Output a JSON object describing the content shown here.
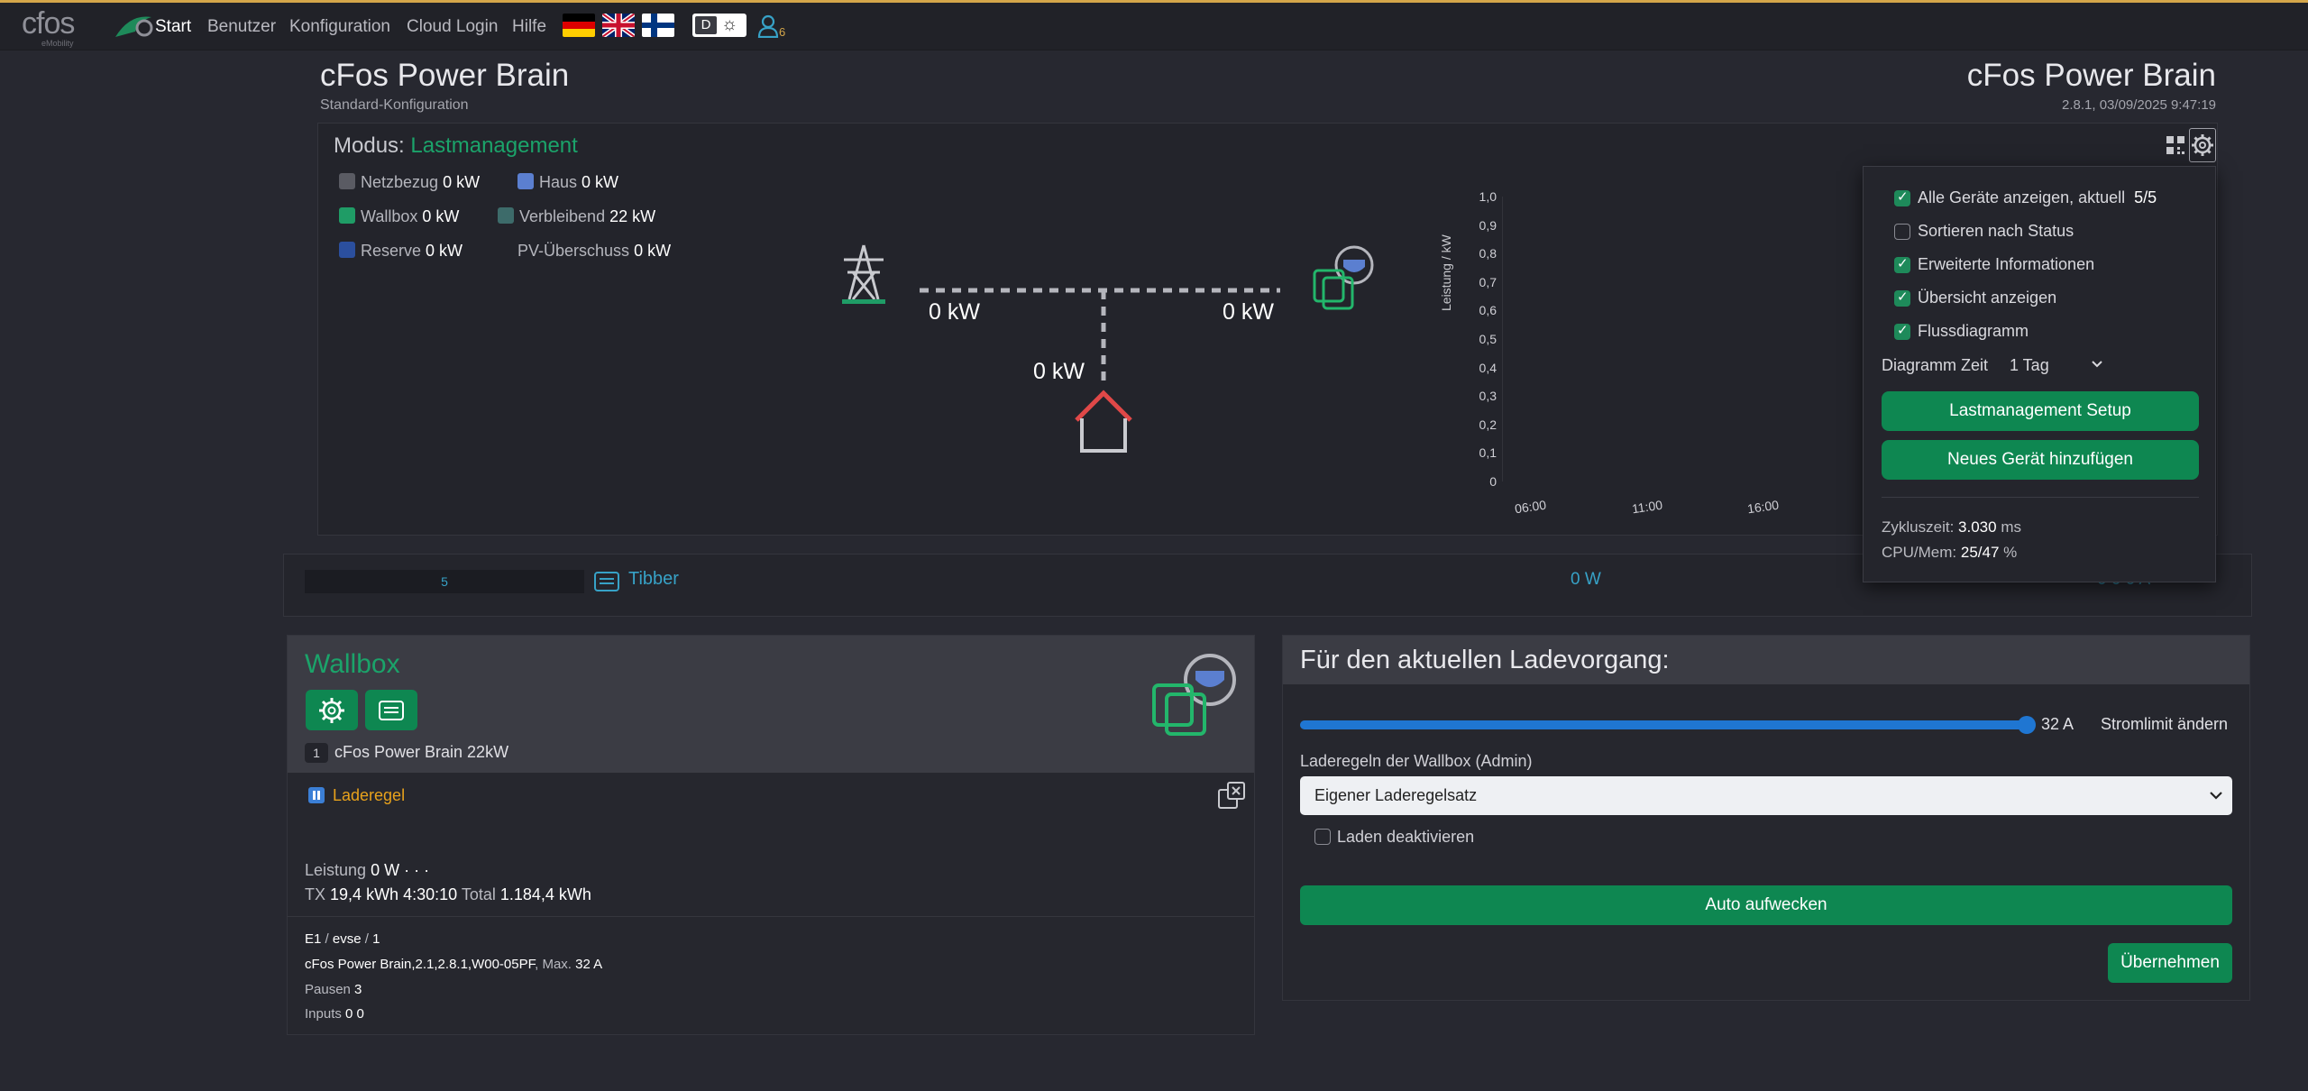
{
  "nav": {
    "logo": "cfos",
    "logo_sub": "eMobility",
    "items": [
      "Start",
      "Benutzer",
      "Konfiguration",
      "Cloud Login",
      "Hilfe"
    ],
    "user_count": "6"
  },
  "header": {
    "title_left": "cFos Power Brain",
    "subtitle_left": "Standard-Konfiguration",
    "title_right": "cFos Power Brain",
    "version_info": "2.8.1, 03/09/2025 9:47:19"
  },
  "mode": {
    "label": "Modus:",
    "value": "Lastmanagement"
  },
  "legend": [
    {
      "name": "Netzbezug",
      "value": "0 kW",
      "color": "#5a5b63"
    },
    {
      "name": "Haus",
      "value": "0 kW",
      "color": "#5b7fd0"
    },
    {
      "name": "Wallbox",
      "value": "0 kW",
      "color": "#1f9c66"
    },
    {
      "name": "Verbleibend",
      "value": "22 kW",
      "color": "#3d6b6a"
    },
    {
      "name": "Reserve",
      "value": "0 kW",
      "color": "#2b4f9e"
    },
    {
      "name": "PV-Überschuss",
      "value": "0 kW",
      "color": ""
    }
  ],
  "flow": {
    "grid": "0 kW",
    "wallbox": "0 kW",
    "house": "0 kW"
  },
  "chart_data": {
    "type": "area",
    "ylabel": "Leistung / kW",
    "yticks": [
      "1,0",
      "0,9",
      "0,8",
      "0,7",
      "0,6",
      "0,5",
      "0,4",
      "0,3",
      "0,2",
      "0,1",
      "0"
    ],
    "xticks": [
      "06:00",
      "11:00",
      "16:00"
    ],
    "ylim": [
      0,
      1.0
    ],
    "series": []
  },
  "dropdown": {
    "options": [
      {
        "label": "Alle Geräte anzeigen, aktuell",
        "extra": "5/5",
        "checked": true
      },
      {
        "label": "Sortieren nach Status",
        "extra": "",
        "checked": false
      },
      {
        "label": "Erweiterte Informationen",
        "extra": "",
        "checked": true
      },
      {
        "label": "Übersicht anzeigen",
        "extra": "",
        "checked": true
      },
      {
        "label": "Flussdiagramm",
        "extra": "",
        "checked": true
      }
    ],
    "diagram_time_label": "Diagramm Zeit",
    "diagram_time_value": "1 Tag",
    "btn_setup": "Lastmanagement Setup",
    "btn_add": "Neues Gerät hinzufügen",
    "cycle_label": "Zykluszeit:",
    "cycle_value": "3.030",
    "cycle_unit": "ms",
    "cpu_label": "CPU/Mem:",
    "cpu_value": "25/47",
    "cpu_unit": "%"
  },
  "meter": {
    "count": "5",
    "name": "Tibber",
    "power": "0 W",
    "current": "0 0 0 A"
  },
  "wallbox": {
    "title": "Wallbox",
    "index": "1",
    "device_name": "cFos Power Brain 22kW",
    "rule_label": "Laderegel",
    "power_label": "Leistung",
    "power_value": "0 W",
    "power_dots": "· · ·",
    "tx_label": "TX",
    "tx_value": "19,4 kWh 4:30:10",
    "total_label": "Total",
    "total_value": "1.184,4 kWh",
    "addr_e": "E1",
    "addr_sep": "/",
    "addr_type": "evse",
    "addr_num": "1",
    "fw": "cFos Power Brain,2.1,2.8.1,W00-05PF",
    "max_label": ", Max.",
    "max_value": "32 A",
    "pausen_label": "Pausen",
    "pausen_value": "3",
    "inputs_label": "Inputs",
    "inputs_value": "0 0"
  },
  "charging": {
    "title": "Für den aktuellen Ladevorgang:",
    "slider_value": "32 A",
    "slider_fraction": 1.0,
    "slider_action": "Stromlimit ändern",
    "rules_label": "Laderegeln der Wallbox (Admin)",
    "rules_selected": "Eigener Laderegelsatz",
    "disable_label": "Laden deaktivieren",
    "wake_btn": "Auto aufwecken",
    "apply_btn": "Übernehmen"
  }
}
